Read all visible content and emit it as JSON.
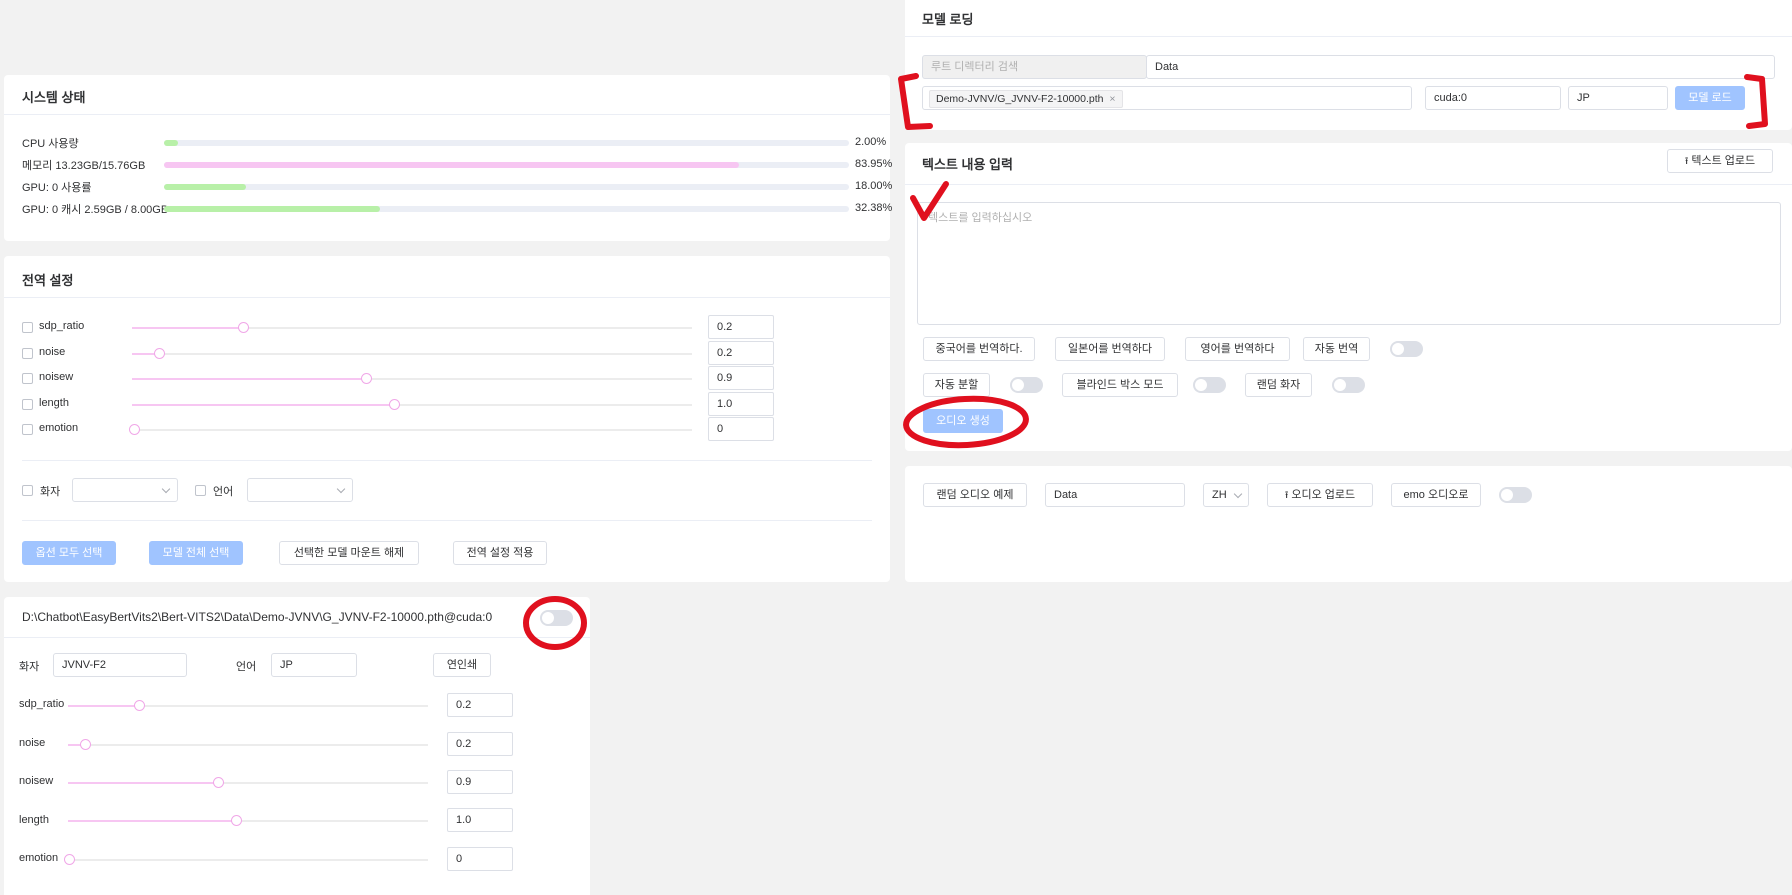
{
  "system": {
    "title": "시스템 상태",
    "stats": [
      {
        "label": "CPU 사용량",
        "value": "2.00%",
        "pct": 2.0,
        "color": "#b8f0a8"
      },
      {
        "label": "메모리 13.23GB/15.76GB",
        "value": "83.95%",
        "pct": 83.95,
        "color": "#f7c6f2"
      },
      {
        "label": "GPU: 0 사용률",
        "value": "18.00%",
        "pct": 18.0,
        "color": "#b8f0a8"
      },
      {
        "label": "GPU: 0 캐시 2.59GB / 8.00GB",
        "value": "32.38%",
        "pct": 32.38,
        "color": "#b8f0a8"
      }
    ]
  },
  "global": {
    "title": "전역 설정",
    "sliders": [
      {
        "name": "sdp_ratio",
        "value": "0.2",
        "frac": 0.2
      },
      {
        "name": "noise",
        "value": "0.2",
        "frac": 0.05
      },
      {
        "name": "noisew",
        "value": "0.9",
        "frac": 0.42
      },
      {
        "name": "length",
        "value": "1.0",
        "frac": 0.47
      },
      {
        "name": "emotion",
        "value": "0",
        "frac": 0.0
      }
    ],
    "speaker_label": "화자",
    "language_label": "언어",
    "buttons": {
      "select_all_options": "옵션 모두 선택",
      "select_all_models": "모델 전체 선택",
      "unmount_selected": "선택한 모델 마운트 해제",
      "apply_global": "전역 설정 적용"
    }
  },
  "model_panel": {
    "path": "D:\\Chatbot\\EasyBertVits2\\Bert-VITS2\\Data\\Demo-JVNV\\G_JVNV-F2-10000.pth@cuda:0",
    "speaker_label": "화자",
    "speaker_value": "JVNV-F2",
    "language_label": "언어",
    "language_value": "JP",
    "print_button": "연인쇄",
    "sliders": [
      {
        "name": "sdp_ratio",
        "value": "0.2",
        "frac": 0.2
      },
      {
        "name": "noise",
        "value": "0.2",
        "frac": 0.05
      },
      {
        "name": "noisew",
        "value": "0.9",
        "frac": 0.42
      },
      {
        "name": "length",
        "value": "1.0",
        "frac": 0.47
      },
      {
        "name": "emotion",
        "value": "0",
        "frac": 0.0
      }
    ]
  },
  "model_loading": {
    "title": "모델 로딩",
    "root_search_placeholder": "루트 디렉터리 검색",
    "root_value": "Data",
    "model_tag": "Demo-JVNV/G_JVNV-F2-10000.pth",
    "device": "cuda:0",
    "language": "JP",
    "load_button": "모델 로드"
  },
  "text_input": {
    "title": "텍스트 내용 입력",
    "upload_button": "텍스트 업로드",
    "placeholder": "텍스트를 입력하십시오",
    "translate_zh": "중국어를 번역하다.",
    "translate_jp": "일본어를 번역하다",
    "translate_en": "영어를 번역하다",
    "auto_translate": "자동 번역",
    "auto_split": "자동 분할",
    "blind_box": "블라인드 박스 모드",
    "random_speaker": "랜덤 화자",
    "generate": "오디오 생성"
  },
  "audio": {
    "random_example": "랜덤 오디오 예제",
    "path_value": "Data",
    "lang": "ZH",
    "upload_button": "오디오 업로드",
    "emo_button": "emo 오디오로"
  },
  "colors": {
    "accent_pink": "#f7c6f2",
    "accent_green": "#b8f0a8",
    "primary_disabled": "#a0c4ff",
    "annotation_red": "#e0101e"
  }
}
